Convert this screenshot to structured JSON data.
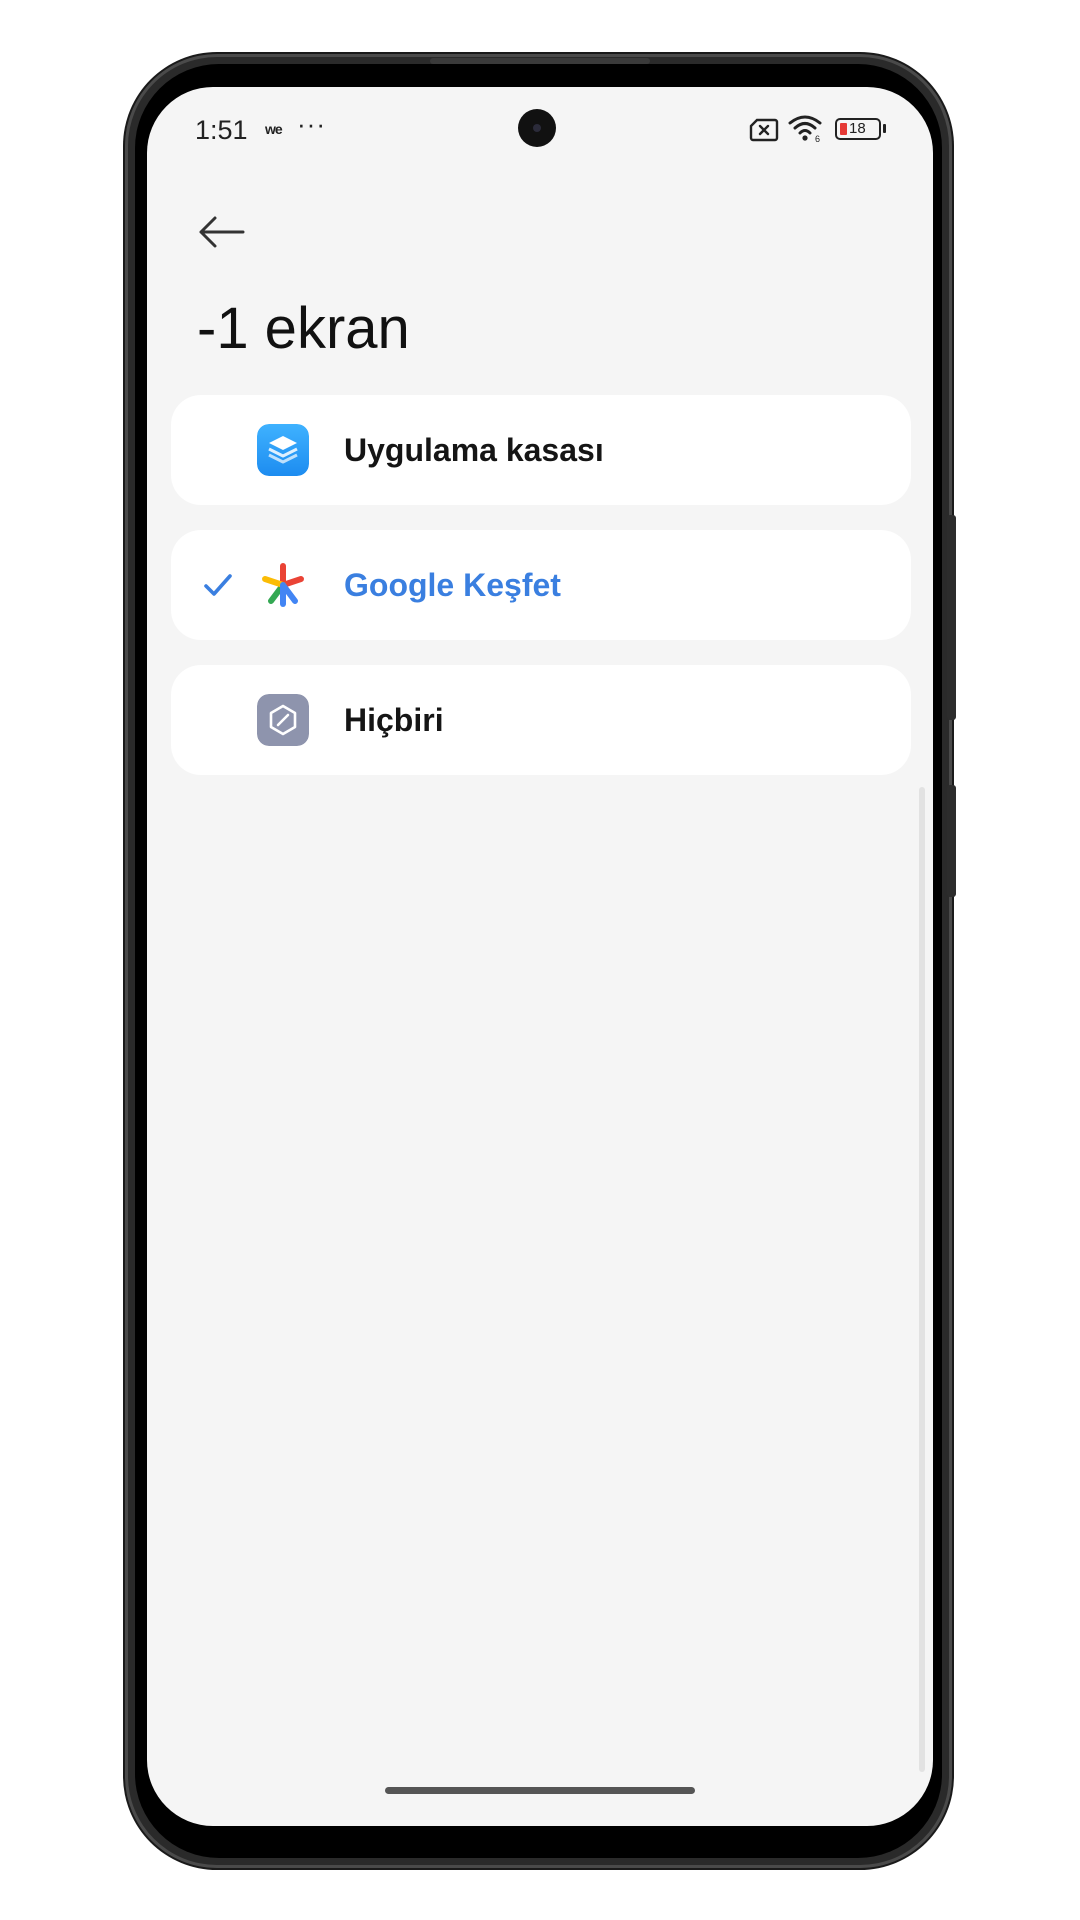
{
  "status_bar": {
    "time": "1:51",
    "carrier": "we",
    "more": "···",
    "battery_level": "18"
  },
  "header": {
    "back_icon": "arrow-left-icon",
    "title": "-1 ekran"
  },
  "options": [
    {
      "label": "Uygulama kasası",
      "icon": "app-vault-layers-icon",
      "selected": false
    },
    {
      "label": "Google Keşfet",
      "icon": "google-discover-icon",
      "selected": true
    },
    {
      "label": "Hiçbiri",
      "icon": "none-slash-icon",
      "selected": false
    }
  ],
  "colors": {
    "accent": "#3a7fe0",
    "background": "#f5f5f5",
    "card": "#ffffff",
    "battery_low": "#e53935"
  }
}
